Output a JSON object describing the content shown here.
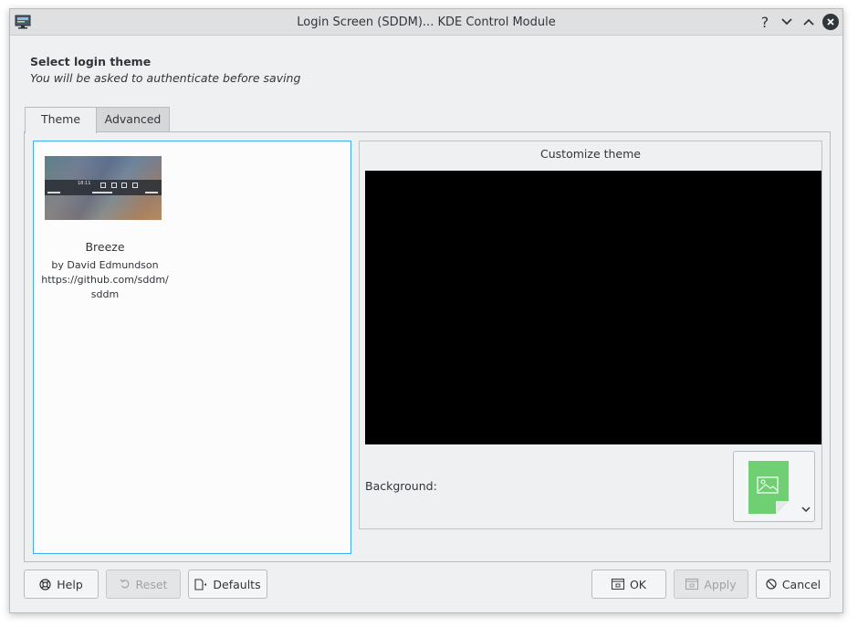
{
  "window": {
    "title": "Login Screen (SDDM)... KDE Control Module",
    "controls": {
      "help": "?",
      "minimize": "⌄",
      "maximize": "⌃",
      "close": "✕"
    }
  },
  "header": {
    "title": "Select login theme",
    "subtitle": "You will be asked to authenticate before saving"
  },
  "tabs": [
    {
      "label": "Theme",
      "active": true
    },
    {
      "label": "Advanced",
      "active": false
    }
  ],
  "themes": [
    {
      "name": "Breeze",
      "author": "by David Edmundson",
      "url_line1": "https://github.com/sddm/",
      "url_line2": "sddm",
      "thumb_time": "18:11"
    }
  ],
  "customize": {
    "title": "Customize theme",
    "background_label": "Background:",
    "background_icon": "image-icon",
    "dropdown_icon": "chevron-down-icon"
  },
  "buttons": {
    "help": {
      "label": "Help",
      "icon": "help-lifebuoy-icon",
      "enabled": true
    },
    "reset": {
      "label": "Reset",
      "icon": "undo-icon",
      "enabled": false
    },
    "defaults": {
      "label": "Defaults",
      "icon": "document-revert-icon",
      "enabled": true
    },
    "ok": {
      "label": "OK",
      "icon": "dialog-ok-icon",
      "enabled": true
    },
    "apply": {
      "label": "Apply",
      "icon": "apply-icon",
      "enabled": false
    },
    "cancel": {
      "label": "Cancel",
      "icon": "cancel-icon",
      "enabled": true
    }
  },
  "colors": {
    "accent": "#3daee9",
    "window_bg": "#eff0f1",
    "text": "#31363b",
    "preview_bg": "#000000",
    "image_icon_green": "#6fcf73"
  }
}
